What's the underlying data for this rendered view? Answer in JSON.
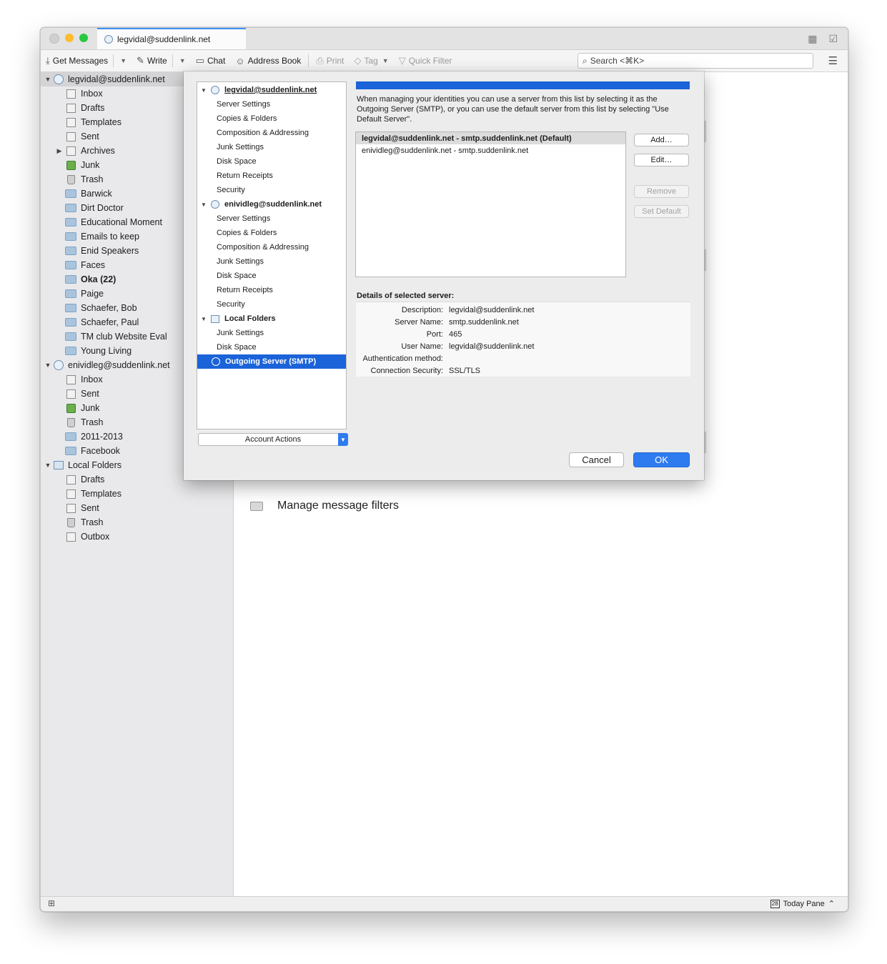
{
  "window": {
    "tab_title": "legvidal@suddenlink.net"
  },
  "toolbar": {
    "get_messages": "Get Messages",
    "write": "Write",
    "chat": "Chat",
    "address_book": "Address Book",
    "print": "Print",
    "tag": "Tag",
    "quick_filter": "Quick Filter",
    "search_placeholder": "Search <⌘K>"
  },
  "sidebar": {
    "items": [
      {
        "label": "legvidal@suddenlink.net",
        "type": "account"
      },
      {
        "label": "Inbox",
        "type": "inbox"
      },
      {
        "label": "Drafts",
        "type": "doc"
      },
      {
        "label": "Templates",
        "type": "doc"
      },
      {
        "label": "Sent",
        "type": "doc"
      },
      {
        "label": "Archives",
        "type": "doc"
      },
      {
        "label": "Junk",
        "type": "junk"
      },
      {
        "label": "Trash",
        "type": "trash"
      },
      {
        "label": "Barwick",
        "type": "folder"
      },
      {
        "label": "Dirt Doctor",
        "type": "folder"
      },
      {
        "label": "Educational Moment",
        "type": "folder"
      },
      {
        "label": "Emails to keep",
        "type": "folder"
      },
      {
        "label": "Enid Speakers",
        "type": "folder"
      },
      {
        "label": "Faces",
        "type": "folder"
      },
      {
        "label": "Oka (22)",
        "type": "folder"
      },
      {
        "label": "Paige",
        "type": "folder"
      },
      {
        "label": "Schaefer, Bob",
        "type": "folder"
      },
      {
        "label": "Schaefer, Paul",
        "type": "folder"
      },
      {
        "label": "TM club Website Eval",
        "type": "folder"
      },
      {
        "label": "Young Living",
        "type": "folder"
      },
      {
        "label": "enividleg@suddenlink.net",
        "type": "account"
      },
      {
        "label": "Inbox",
        "type": "inbox"
      },
      {
        "label": "Sent",
        "type": "doc"
      },
      {
        "label": "Junk",
        "type": "junk"
      },
      {
        "label": "Trash",
        "type": "trash"
      },
      {
        "label": "2011-2013",
        "type": "folder"
      },
      {
        "label": "Facebook",
        "type": "folder"
      },
      {
        "label": "Local Folders",
        "type": "local"
      },
      {
        "label": "Drafts",
        "type": "doc"
      },
      {
        "label": "Templates",
        "type": "doc"
      },
      {
        "label": "Sent",
        "type": "doc"
      },
      {
        "label": "Trash",
        "type": "trash"
      },
      {
        "label": "Outbox",
        "type": "doc"
      }
    ]
  },
  "main": {
    "manage_filters": "Manage message filters"
  },
  "statusbar": {
    "today_pane": "Today Pane",
    "calendar_day": "28"
  },
  "dialog": {
    "tree": [
      {
        "label": "legvidal@suddenlink.net",
        "kind": "account"
      },
      {
        "label": "Server Settings",
        "kind": "child"
      },
      {
        "label": "Copies & Folders",
        "kind": "child"
      },
      {
        "label": "Composition & Addressing",
        "kind": "child"
      },
      {
        "label": "Junk Settings",
        "kind": "child"
      },
      {
        "label": "Disk Space",
        "kind": "child"
      },
      {
        "label": "Return Receipts",
        "kind": "child"
      },
      {
        "label": "Security",
        "kind": "child"
      },
      {
        "label": "enividleg@suddenlink.net",
        "kind": "account"
      },
      {
        "label": "Server Settings",
        "kind": "child"
      },
      {
        "label": "Copies & Folders",
        "kind": "child"
      },
      {
        "label": "Composition & Addressing",
        "kind": "child"
      },
      {
        "label": "Junk Settings",
        "kind": "child"
      },
      {
        "label": "Disk Space",
        "kind": "child"
      },
      {
        "label": "Return Receipts",
        "kind": "child"
      },
      {
        "label": "Security",
        "kind": "child"
      },
      {
        "label": "Local Folders",
        "kind": "local"
      },
      {
        "label": "Junk Settings",
        "kind": "child"
      },
      {
        "label": "Disk Space",
        "kind": "child"
      },
      {
        "label": "Outgoing Server (SMTP)",
        "kind": "smtp"
      }
    ],
    "account_actions": "Account Actions",
    "description": "When managing your identities you can use a server from this list by selecting it as the Outgoing Server (SMTP), or you can use the default server from this list by selecting \"Use Default Server\".",
    "servers": [
      "legvidal@suddenlink.net - smtp.suddenlink.net (Default)",
      "enividleg@suddenlink.net - smtp.suddenlink.net"
    ],
    "buttons": {
      "add": "Add…",
      "edit": "Edit…",
      "remove": "Remove",
      "set_default": "Set Default",
      "cancel": "Cancel",
      "ok": "OK"
    },
    "details_title": "Details of selected server:",
    "details": [
      {
        "label": "Description:",
        "value": "legvidal@suddenlink.net"
      },
      {
        "label": "Server Name:",
        "value": "smtp.suddenlink.net"
      },
      {
        "label": "Port:",
        "value": "465"
      },
      {
        "label": "User Name:",
        "value": "legvidal@suddenlink.net"
      },
      {
        "label": "Authentication method:",
        "value": ""
      },
      {
        "label": "Connection Security:",
        "value": "SSL/TLS"
      }
    ]
  }
}
